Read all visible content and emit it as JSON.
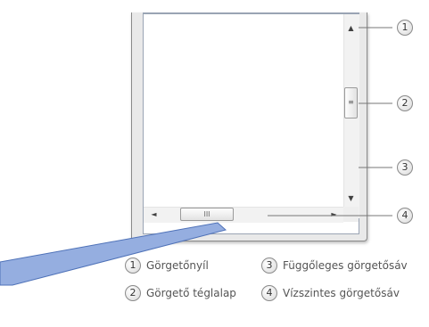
{
  "scrollbar": {
    "up_arrow": "▲",
    "down_arrow": "▼",
    "left_arrow": "◄",
    "right_arrow": "►",
    "v_thumb_grip": "≡",
    "h_thumb_grip": "III"
  },
  "callouts": [
    "1",
    "2",
    "3",
    "4"
  ],
  "legend": [
    {
      "num": "1",
      "label": "Görgetőnyíl"
    },
    {
      "num": "2",
      "label": "Görgető téglalap"
    },
    {
      "num": "3",
      "label": "Függőleges görgetősáv"
    },
    {
      "num": "4",
      "label": "Vízszintes görgetősáv"
    }
  ],
  "colors": {
    "pointer_fill": "#95aee0",
    "pointer_stroke": "#4f72b8"
  }
}
